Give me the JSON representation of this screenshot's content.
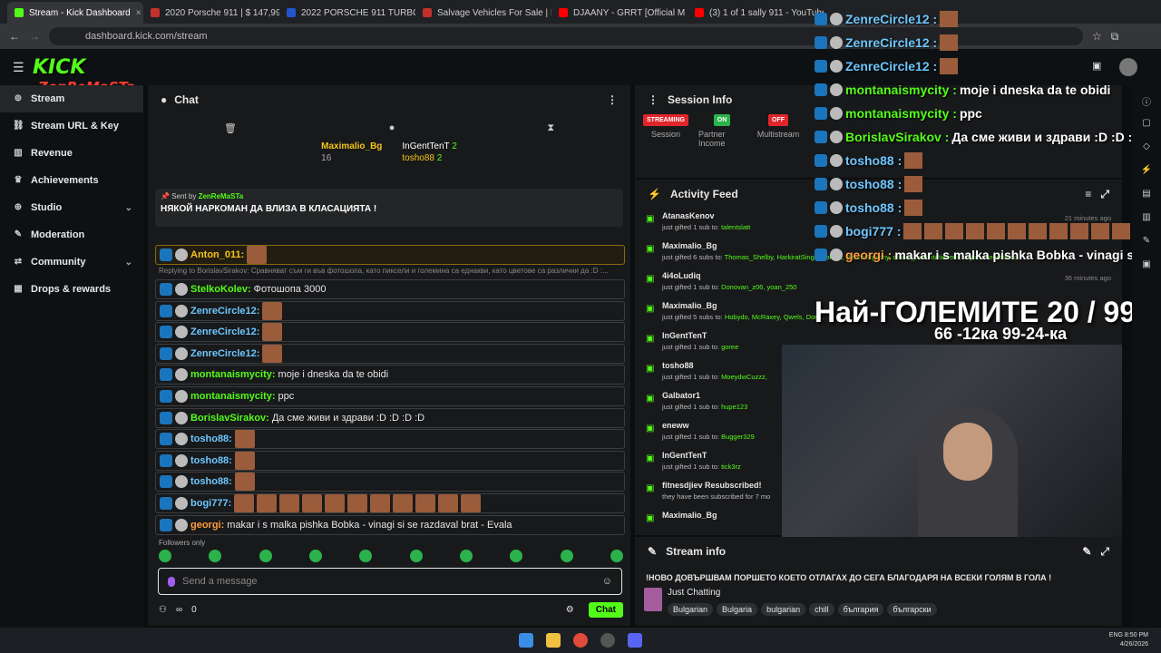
{
  "browser": {
    "tabs": [
      {
        "label": "Stream - Kick Dashboard",
        "color": "#53fc18",
        "active": true
      },
      {
        "label": "2020 Porsche 911 | $ 147,995 |",
        "color": "#c4302b",
        "active": false
      },
      {
        "label": "2022 PORSCHE 911 TURBO | E",
        "color": "#2255cc",
        "active": false
      },
      {
        "label": "Salvage Vehicles For Sale | IAA",
        "color": "#c4302b",
        "active": false
      },
      {
        "label": "DJAANY - GRRT [Official M",
        "color": "#ff0000",
        "active": false
      },
      {
        "label": "(3) 1 of 1 sally 911 - YouTube",
        "color": "#ff0000",
        "active": false
      }
    ],
    "url": "dashboard.kick.com/stream"
  },
  "logo": {
    "kick": "KICK",
    "zen": "ZenReMaSTa"
  },
  "sidebar": {
    "items": [
      {
        "label": "Stream",
        "icon": "broadcast-icon",
        "active": true
      },
      {
        "label": "Stream URL & Key",
        "icon": "link-icon"
      },
      {
        "label": "Revenue",
        "icon": "chart-icon"
      },
      {
        "label": "Achievements",
        "icon": "trophy-icon"
      },
      {
        "label": "Studio",
        "icon": "globe-icon",
        "chevron": true
      },
      {
        "label": "Moderation",
        "icon": "wrench-icon"
      },
      {
        "label": "Community",
        "icon": "share-icon",
        "chevron": true
      },
      {
        "label": "Drops & rewards",
        "icon": "grid-icon"
      }
    ]
  },
  "chat": {
    "title": "Chat",
    "gifters": [
      {
        "name": "Maximalio_Bg",
        "count": "16"
      },
      {
        "name": "InGentTenT",
        "count": "2"
      },
      {
        "name": "tosho88",
        "count": "2"
      }
    ],
    "pinned": {
      "by_label": "Sent by",
      "by_user": "ZenReMaSTa",
      "message": "НЯКОЙ НАРКОМАН ДА ВЛИЗА В КЛАСАЦИЯТА !"
    },
    "messages": [
      {
        "user": "Anton_011:",
        "text": "",
        "emotes": 1,
        "color": "#f5c518",
        "style": "gold"
      },
      {
        "reply": "Replying to BorislavSirakov: Сравняват съм ги във фотошопа, като пиксели и големина са еднакви, като цветове са различни да :D :..."
      },
      {
        "user": "StelkoKolev:",
        "text": "Фотошопа 3000",
        "emotes": 0,
        "color": "#53fc18"
      },
      {
        "user": "ZenreCircle12:",
        "text": "",
        "emotes": 1,
        "color": "#6ec6ff"
      },
      {
        "user": "ZenreCircle12:",
        "text": "",
        "emotes": 1,
        "color": "#6ec6ff"
      },
      {
        "user": "ZenreCircle12:",
        "text": "",
        "emotes": 1,
        "color": "#6ec6ff"
      },
      {
        "user": "montanaismycity:",
        "text": "moje i dneska da te obidi",
        "emotes": 0,
        "color": "#53fc18"
      },
      {
        "user": "montanaismycity:",
        "text": "ppc",
        "emotes": 0,
        "color": "#53fc18"
      },
      {
        "user": "BorislavSirakov:",
        "text": "Да сме живи и здрави :D :D :D :D",
        "emotes": 0,
        "color": "#53fc18"
      },
      {
        "user": "tosho88:",
        "text": "",
        "emotes": 1,
        "color": "#6ec6ff"
      },
      {
        "user": "tosho88:",
        "text": "",
        "emotes": 1,
        "color": "#6ec6ff"
      },
      {
        "user": "tosho88:",
        "text": "",
        "emotes": 1,
        "color": "#6ec6ff"
      },
      {
        "user": "bogi777:",
        "text": "",
        "emotes": 11,
        "color": "#6ec6ff"
      },
      {
        "user": "georgi:",
        "text": "makar i s malka pishka Bobka - vinagi si se razdaval brat - Evala",
        "emotes": 0,
        "color": "#ff9e3d"
      }
    ],
    "followers_only": "Followers only",
    "input_placeholder": "Send a message",
    "footer_count": "0",
    "send_label": "Chat"
  },
  "session": {
    "title": "Session Info",
    "stats": [
      {
        "pill": "STREAMING",
        "pill_color": "#e0262b",
        "label": "Session"
      },
      {
        "pill": "ON",
        "pill_color": "#2bb24c",
        "label": "Partner Income"
      },
      {
        "pill": "OFF",
        "pill_color": "#e0262b",
        "label": "Multistream"
      }
    ]
  },
  "activity": {
    "title": "Activity Feed",
    "items": [
      {
        "name": "AtanasKenov",
        "desc": "just gifted 1 sub to:",
        "to": "talentslatt",
        "time": "21 minutes ago"
      },
      {
        "name": "Maximalio_Bg",
        "desc": "just gifted 6 subs to:",
        "to": "Thomas_Shelby, HarkiratSingh, pontita, BeansSquishy, omnis_exercitationem, Vigocurvehurohud",
        "time": ""
      },
      {
        "name": "4i4oLudiq",
        "desc": "just gifted 1 sub to:",
        "to": "Donovan_z06, yoan_250",
        "time": "36 minutes ago"
      },
      {
        "name": "Maximalio_Bg",
        "desc": "just gifted 5 subs to:",
        "to": "Hobydo, McRaxey, Qwels, Don...",
        "time": ""
      },
      {
        "name": "InGentTenT",
        "desc": "just gifted 1 sub to:",
        "to": "goree",
        "time": ""
      },
      {
        "name": "tosho88",
        "desc": "just gifted 1 sub to:",
        "to": "MoeydwCuzzz,",
        "time": ""
      },
      {
        "name": "Galbator1",
        "desc": "just gifted 1 sub to:",
        "to": "hupe123",
        "time": ""
      },
      {
        "name": "eneww",
        "desc": "just gifted 1 sub to:",
        "to": "Bugger329",
        "time": ""
      },
      {
        "name": "InGentTenT",
        "desc": "just gifted 1 sub to:",
        "to": "tick3rz",
        "time": ""
      },
      {
        "name": "fitnesdjiev Resubscribed!",
        "desc": "they have been subscribed for 7 mo",
        "to": "",
        "time": ""
      },
      {
        "name": "Maximalio_Bg",
        "desc": "",
        "to": "",
        "time": ""
      }
    ]
  },
  "stream_info": {
    "title": "Stream info",
    "stream_title": "!НОВО ДОВЪРШВАМ ПОРШЕТО КОЕТО ОТЛАГАХ ДО СЕГА БЛАГОДАРЯ НА ВСЕКИ ГОЛЯМ В ГОЛА !",
    "category": "Just Chatting",
    "tags": [
      "Bulgarian",
      "Bulgaria",
      "bulgarian",
      "chill",
      "българия",
      "български"
    ]
  },
  "overlay": {
    "lines": [
      {
        "user": "ZenreCircle12 :",
        "text": "",
        "color": "blue",
        "emotes": 1
      },
      {
        "user": "ZenreCircle12 :",
        "text": "",
        "color": "blue",
        "emotes": 1
      },
      {
        "user": "ZenreCircle12 :",
        "text": "",
        "color": "blue",
        "emotes": 1
      },
      {
        "user": "montanaismycity :",
        "text": "moje i dneska da te obidi",
        "color": "green",
        "emotes": 0
      },
      {
        "user": "montanaismycity :",
        "text": "ppc",
        "color": "green",
        "emotes": 0
      },
      {
        "user": "BorislavSirakov :",
        "text": "Да сме живи и здрави :D :D :D",
        "color": "green",
        "emotes": 0
      },
      {
        "user": "tosho88 :",
        "text": "",
        "color": "blue",
        "emotes": 1
      },
      {
        "user": "tosho88 :",
        "text": "",
        "color": "blue",
        "emotes": 1
      },
      {
        "user": "tosho88 :",
        "text": "",
        "color": "blue",
        "emotes": 1
      },
      {
        "user": "bogi777 :",
        "text": "",
        "color": "blue",
        "emotes": 11
      },
      {
        "user": "georgi :",
        "text": "makar i s malka pishka Bobka - vinagi si s",
        "color": "orange",
        "emotes": 0
      }
    ],
    "big_title": "Най-ГОЛЕМИТЕ 20 / 99",
    "subtitle": "66 -12ка 99-24-ка"
  },
  "taskbar": {
    "lang": "ENG",
    "time": "8:50 PM",
    "date": "4/26/2026"
  }
}
